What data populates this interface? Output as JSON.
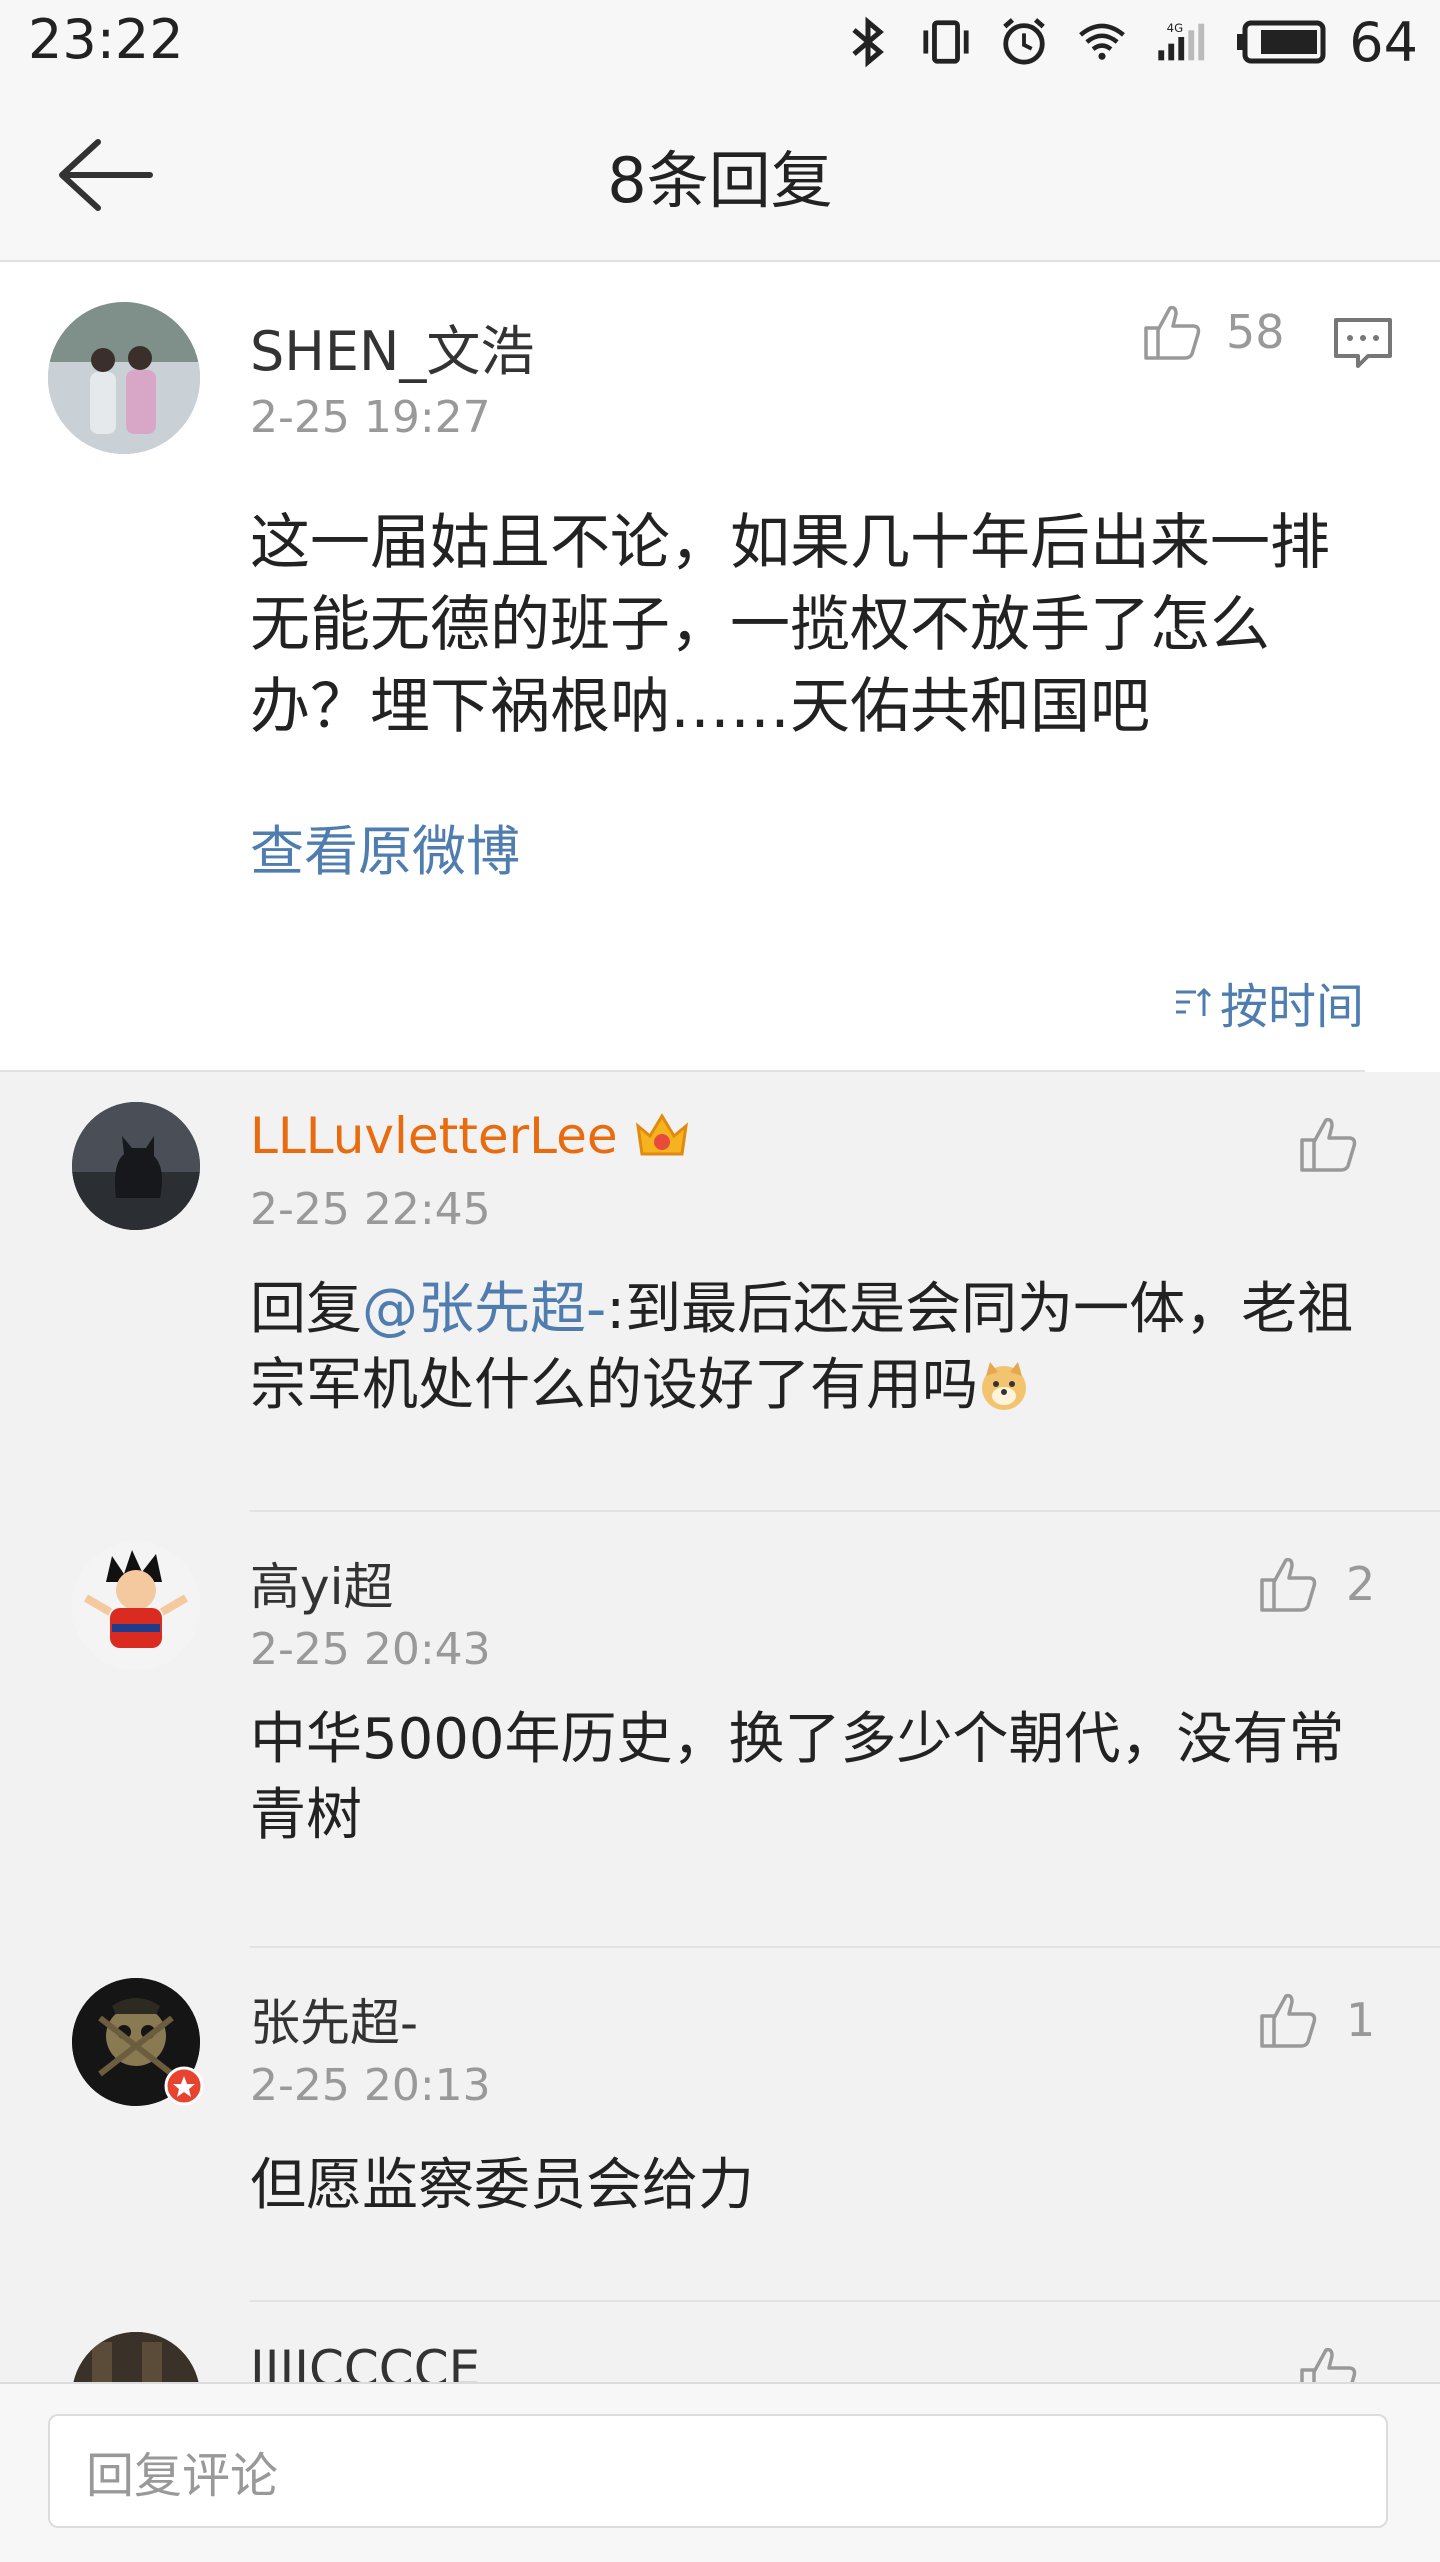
{
  "status_bar": {
    "time": "23:22",
    "battery": "64"
  },
  "nav": {
    "title": "8条回复"
  },
  "original_comment": {
    "username": "SHEN_文浩",
    "date": "2-25 19:27",
    "likes": "58",
    "text": "这一届姑且不论，如果几十年后出来一排无能无德的班子，一揽权不放手了怎么办？埋下祸根呐……天佑共和国吧",
    "view_original": "查看原微博",
    "sort_label": "按时间"
  },
  "replies": [
    {
      "username": "LLLuvletterLee",
      "vip": true,
      "date": "2-25 22:45",
      "likes": "",
      "prefix": "回复",
      "mention": "@张先超-",
      "text": ":到最后还是会同为一体，老祖宗军机处什么的设好了有用吗"
    },
    {
      "username": "高yi超",
      "date": "2-25 20:43",
      "likes": "2",
      "text": "中华5000年历史，换了多少个朝代，没有常青树"
    },
    {
      "username": "张先超-",
      "date": "2-25 20:13",
      "likes": "1",
      "text": "但愿监察委员会给力"
    },
    {
      "username": "IIIICCCCE"
    }
  ],
  "bottom": {
    "placeholder": "回复评论"
  },
  "colors": {
    "link": "#507daf",
    "vip_name": "#e86b0f",
    "background": "#f2f2f2"
  }
}
